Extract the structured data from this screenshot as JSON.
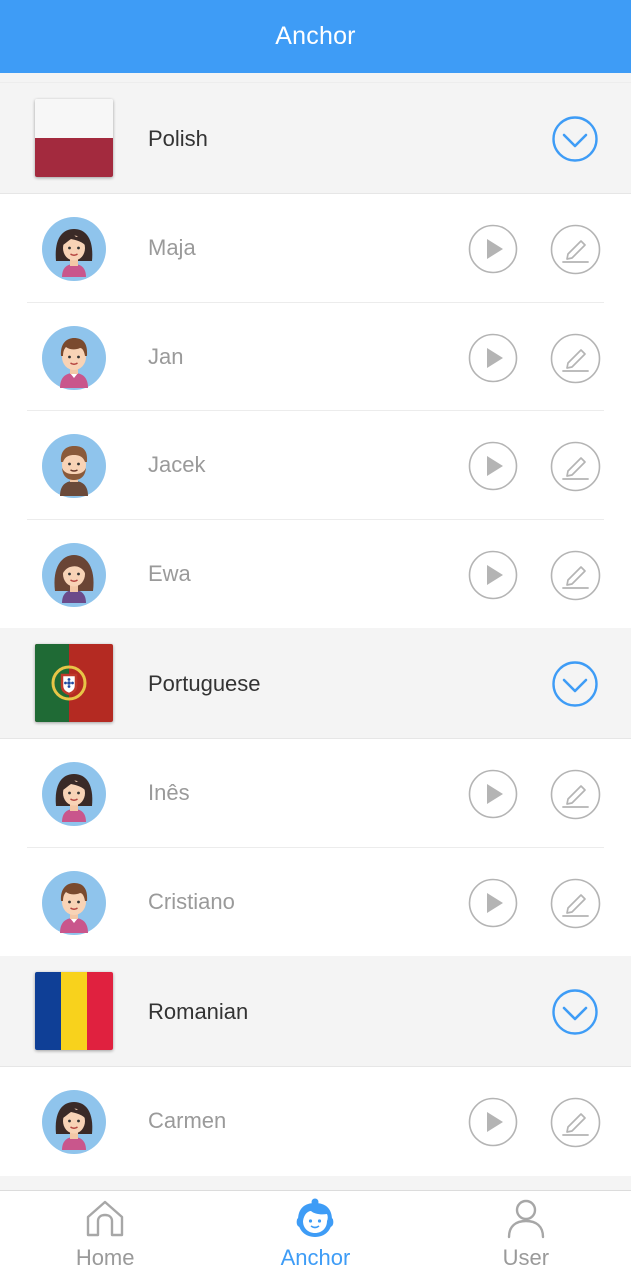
{
  "header": {
    "title": "Anchor"
  },
  "colors": {
    "accent": "#3e9cf6",
    "icon_gray": "#b4b4b4",
    "text_gray": "#9a9a9a"
  },
  "groups": [
    {
      "language": "Polish",
      "flag": "poland-flag",
      "anchors": [
        {
          "name": "Maja",
          "avatar": "female-avatar"
        },
        {
          "name": "Jan",
          "avatar": "male-avatar"
        },
        {
          "name": "Jacek",
          "avatar": "male-beard-avatar"
        },
        {
          "name": "Ewa",
          "avatar": "female-avatar"
        }
      ]
    },
    {
      "language": "Portuguese",
      "flag": "portugal-flag",
      "anchors": [
        {
          "name": "Inês",
          "avatar": "female-avatar"
        },
        {
          "name": "Cristiano",
          "avatar": "male-avatar"
        }
      ]
    },
    {
      "language": "Romanian",
      "flag": "romania-flag",
      "anchors": [
        {
          "name": "Carmen",
          "avatar": "female-avatar"
        }
      ]
    }
  ],
  "tabbar": {
    "tabs": [
      {
        "label": "Home",
        "icon": "home-icon",
        "active": false
      },
      {
        "label": "Anchor",
        "icon": "anchor-icon",
        "active": true
      },
      {
        "label": "User",
        "icon": "user-icon",
        "active": false
      }
    ]
  }
}
